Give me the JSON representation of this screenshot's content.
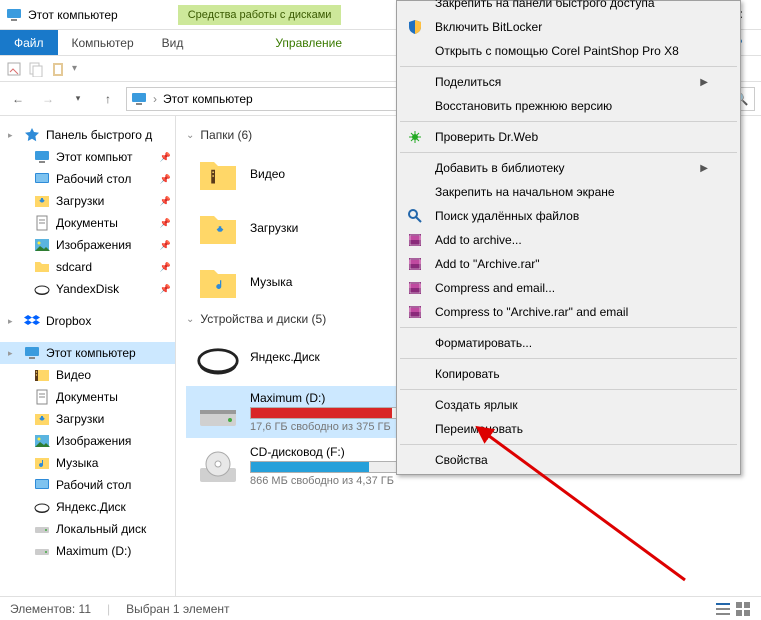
{
  "window": {
    "title": "Этот компьютер",
    "ribbon_tool": "Средства работы с дисками",
    "close": "✕"
  },
  "menu": {
    "file": "Файл",
    "computer": "Компьютер",
    "view": "Вид",
    "manage": "Управление",
    "help": "?"
  },
  "address": {
    "root_sep": "›",
    "location": "Этот компьютер"
  },
  "sidebar": {
    "quick": {
      "label": "Панель быстрого д",
      "items": [
        {
          "label": "Этот компьют",
          "icon": "pc"
        },
        {
          "label": "Рабочий стол",
          "icon": "desktop"
        },
        {
          "label": "Загрузки",
          "icon": "down"
        },
        {
          "label": "Документы",
          "icon": "doc"
        },
        {
          "label": "Изображения",
          "icon": "pic"
        },
        {
          "label": "sdcard",
          "icon": "folder"
        },
        {
          "label": "YandexDisk",
          "icon": "yadisk"
        }
      ]
    },
    "dropbox": {
      "label": "Dropbox"
    },
    "thispc": {
      "label": "Этот компьютер",
      "items": [
        {
          "label": "Видео",
          "icon": "video"
        },
        {
          "label": "Документы",
          "icon": "doc"
        },
        {
          "label": "Загрузки",
          "icon": "down"
        },
        {
          "label": "Изображения",
          "icon": "pic"
        },
        {
          "label": "Музыка",
          "icon": "music"
        },
        {
          "label": "Рабочий стол",
          "icon": "desktop"
        },
        {
          "label": "Яндекс.Диск",
          "icon": "yadisk"
        },
        {
          "label": "Локальный диск",
          "icon": "drive"
        },
        {
          "label": "Maximum (D:)",
          "icon": "drive"
        }
      ]
    }
  },
  "content": {
    "folders_hdr": "Папки (6)",
    "folders": [
      {
        "label": "Видео",
        "icon": "video"
      },
      {
        "label": "Загрузки",
        "icon": "down"
      },
      {
        "label": "Музыка",
        "icon": "music"
      }
    ],
    "drives_hdr": "Устройства и диски (5)",
    "drives": [
      {
        "label": "Яндекс.Диск",
        "icon": "yadisk",
        "free": "",
        "pct": 0,
        "bar": false
      },
      {
        "label": "Maximum (D:)",
        "icon": "hdd",
        "free": "17,6 ГБ свободно из 375 ГБ",
        "pct": 95,
        "bar": true,
        "red": true,
        "selected": true
      },
      {
        "label": "CD-дисковод (F:)",
        "icon": "cd",
        "free": "866 МБ свободно из 4,37 ГБ",
        "pct": 80,
        "bar": true
      }
    ]
  },
  "context": [
    {
      "t": "Закрепить на панели быстрого доступа",
      "cut": true
    },
    {
      "t": "Включить BitLocker",
      "i": "shield"
    },
    {
      "t": "Открыть с помощью Corel PaintShop Pro X8"
    },
    {
      "sep": true
    },
    {
      "t": "Поделиться",
      "sub": true
    },
    {
      "t": "Восстановить прежнюю версию"
    },
    {
      "sep": true
    },
    {
      "t": "Проверить Dr.Web",
      "i": "spider"
    },
    {
      "sep": true
    },
    {
      "t": "Добавить в библиотеку",
      "sub": true
    },
    {
      "t": "Закрепить на начальном экране"
    },
    {
      "t": "Поиск удалённых файлов",
      "i": "search"
    },
    {
      "t": "Add to archive...",
      "i": "rar"
    },
    {
      "t": "Add to \"Archive.rar\"",
      "i": "rar"
    },
    {
      "t": "Compress and email...",
      "i": "rar"
    },
    {
      "t": "Compress to \"Archive.rar\" and email",
      "i": "rar"
    },
    {
      "sep": true
    },
    {
      "t": "Форматировать..."
    },
    {
      "sep": true
    },
    {
      "t": "Копировать"
    },
    {
      "sep": true
    },
    {
      "t": "Создать ярлык"
    },
    {
      "t": "Переименовать"
    },
    {
      "sep": true
    },
    {
      "t": "Свойства"
    }
  ],
  "status": {
    "count": "Элементов: 11",
    "selected": "Выбран 1 элемент"
  }
}
